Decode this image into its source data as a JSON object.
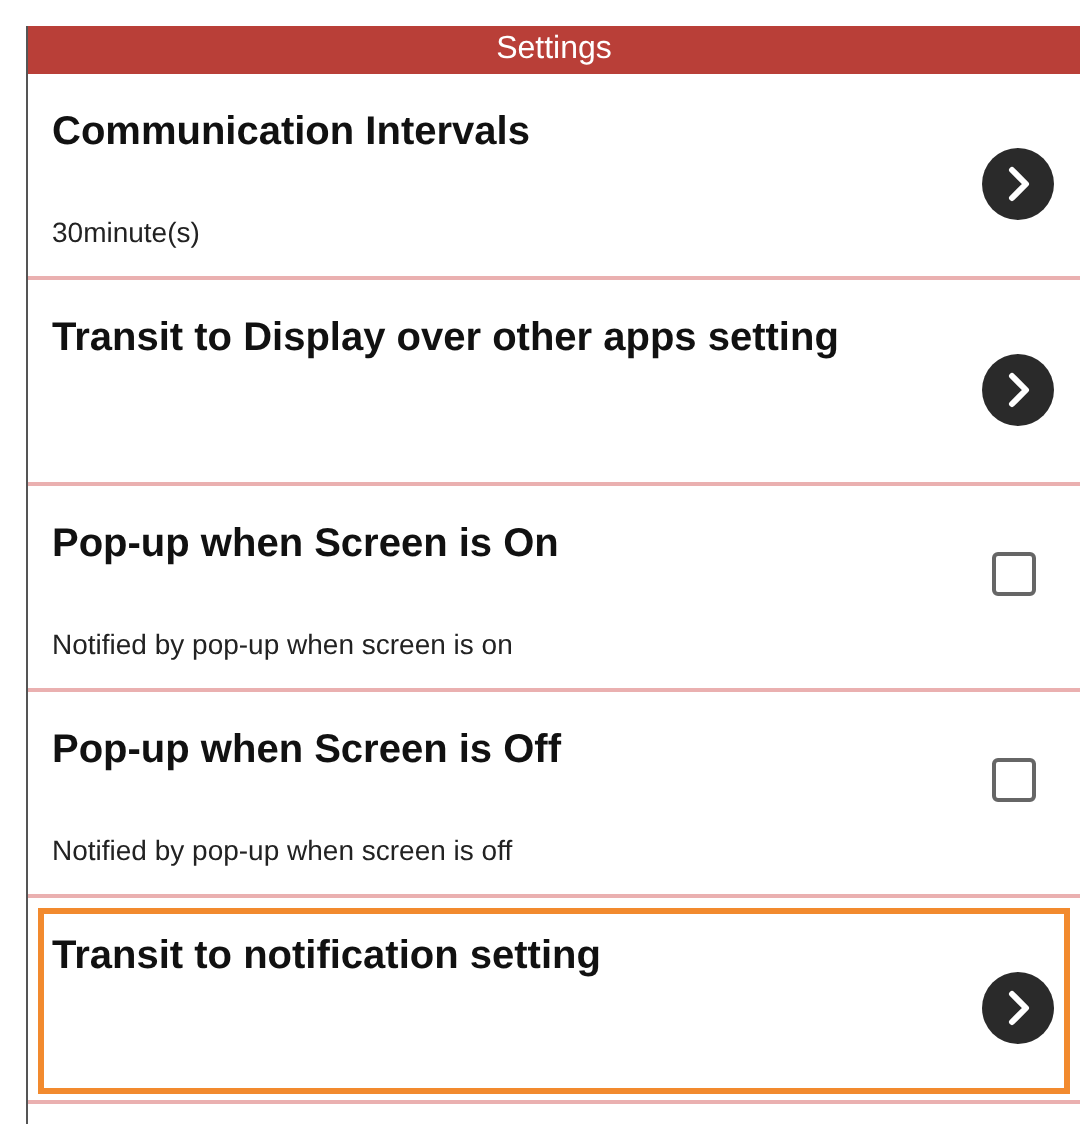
{
  "header": {
    "title": "Settings"
  },
  "items": [
    {
      "kind": "link",
      "title": "Communication Intervals",
      "subtitle": "30minute(s)",
      "selected": false
    },
    {
      "kind": "link",
      "title": "Transit to Display over other apps setting",
      "selected": false
    },
    {
      "kind": "checkbox",
      "title": "Pop-up when Screen is On",
      "subtitle": "Notified by pop-up when screen is on",
      "checked": false,
      "selected": false
    },
    {
      "kind": "checkbox",
      "title": "Pop-up when Screen is Off",
      "subtitle": "Notified by pop-up when screen is off",
      "checked": false,
      "selected": false
    },
    {
      "kind": "link",
      "title": "Transit to notification setting",
      "selected": true
    }
  ]
}
